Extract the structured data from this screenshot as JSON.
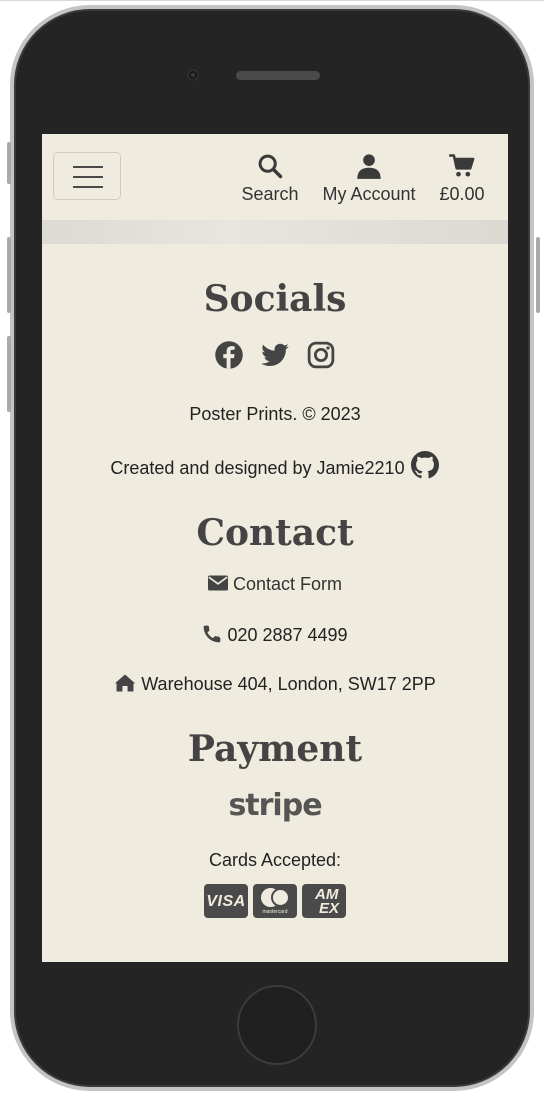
{
  "nav": {
    "search_label": "Search",
    "account_label": "My Account",
    "cart_total": "£0.00"
  },
  "socials": {
    "heading": "Socials",
    "icons": [
      "facebook-icon",
      "twitter-icon",
      "instagram-icon"
    ]
  },
  "copyright": "Poster Prints. © 2023",
  "credit": "Created and designed by Jamie2210",
  "contact": {
    "heading": "Contact",
    "form_link": "Contact Form",
    "phone": "020 2887 4499",
    "address": "Warehouse 404, London, SW17 2PP"
  },
  "payment": {
    "heading": "Payment",
    "provider": "stripe",
    "cards_label": "Cards Accepted:",
    "visa": "VISA",
    "mastercard": "mastercard",
    "amex_top": "AM",
    "amex_bottom": "EX"
  },
  "colors": {
    "background": "#efebdf",
    "text": "#222222",
    "icon": "#444444",
    "phone_frame": "#242424"
  }
}
